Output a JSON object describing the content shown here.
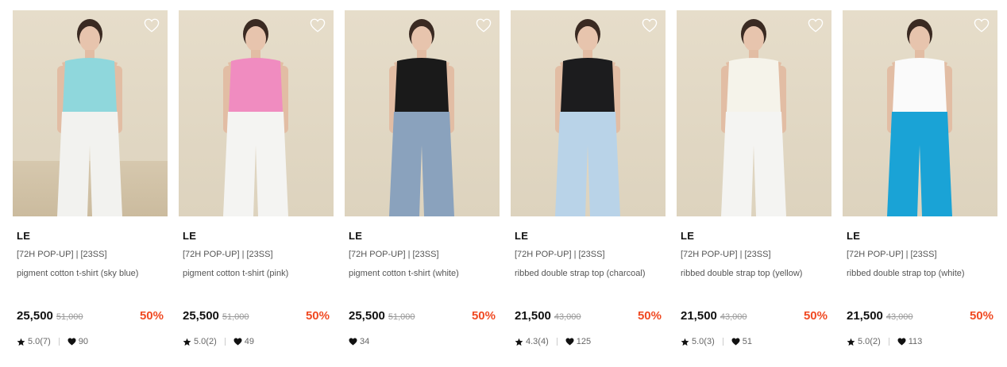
{
  "products": [
    {
      "brand": "LE",
      "tag": "[72H POP-UP] | [23SS]",
      "name": "pigment cotton t-shirt (sky blue)",
      "price": "25,500",
      "original_price": "51,000",
      "discount": "50%",
      "rating": "5.0(7)",
      "likes": "90",
      "top_color": "#8fd7dc",
      "bottom_color": "#f2f2ef",
      "icon": "heart-outline-icon"
    },
    {
      "brand": "LE",
      "tag": "[72H POP-UP] | [23SS]",
      "name": "pigment cotton t-shirt (pink)",
      "price": "25,500",
      "original_price": "51,000",
      "discount": "50%",
      "rating": "5.0(2)",
      "likes": "49",
      "top_color": "#f08cc0",
      "bottom_color": "#f4f4f2",
      "icon": "heart-outline-icon"
    },
    {
      "brand": "LE",
      "tag": "[72H POP-UP] | [23SS]",
      "name": "pigment cotton t-shirt (white)",
      "price": "25,500",
      "original_price": "51,000",
      "discount": "50%",
      "rating": "",
      "likes": "34",
      "top_color": "#1a1a1a",
      "bottom_color": "#8aa2bd",
      "icon": "heart-outline-icon"
    },
    {
      "brand": "LE",
      "tag": "[72H POP-UP] | [23SS]",
      "name": "ribbed double strap top (charcoal)",
      "price": "21,500",
      "original_price": "43,000",
      "discount": "50%",
      "rating": "4.3(4)",
      "likes": "125",
      "top_color": "#1c1c1e",
      "bottom_color": "#b9d3e8",
      "icon": "heart-outline-icon"
    },
    {
      "brand": "LE",
      "tag": "[72H POP-UP] | [23SS]",
      "name": "ribbed double strap top (yellow)",
      "price": "21,500",
      "original_price": "43,000",
      "discount": "50%",
      "rating": "5.0(3)",
      "likes": "51",
      "top_color": "#f5f3ea",
      "bottom_color": "#f4f4f2",
      "icon": "heart-outline-icon"
    },
    {
      "brand": "LE",
      "tag": "[72H POP-UP] | [23SS]",
      "name": "ribbed double strap top (white)",
      "price": "21,500",
      "original_price": "43,000",
      "discount": "50%",
      "rating": "5.0(2)",
      "likes": "113",
      "top_color": "#fafafa",
      "bottom_color": "#1aa3d6",
      "icon": "heart-outline-icon"
    }
  ],
  "colors": {
    "discount": "#f04a23",
    "price": "#111111",
    "muted": "#555555",
    "background": "#ffffff"
  }
}
